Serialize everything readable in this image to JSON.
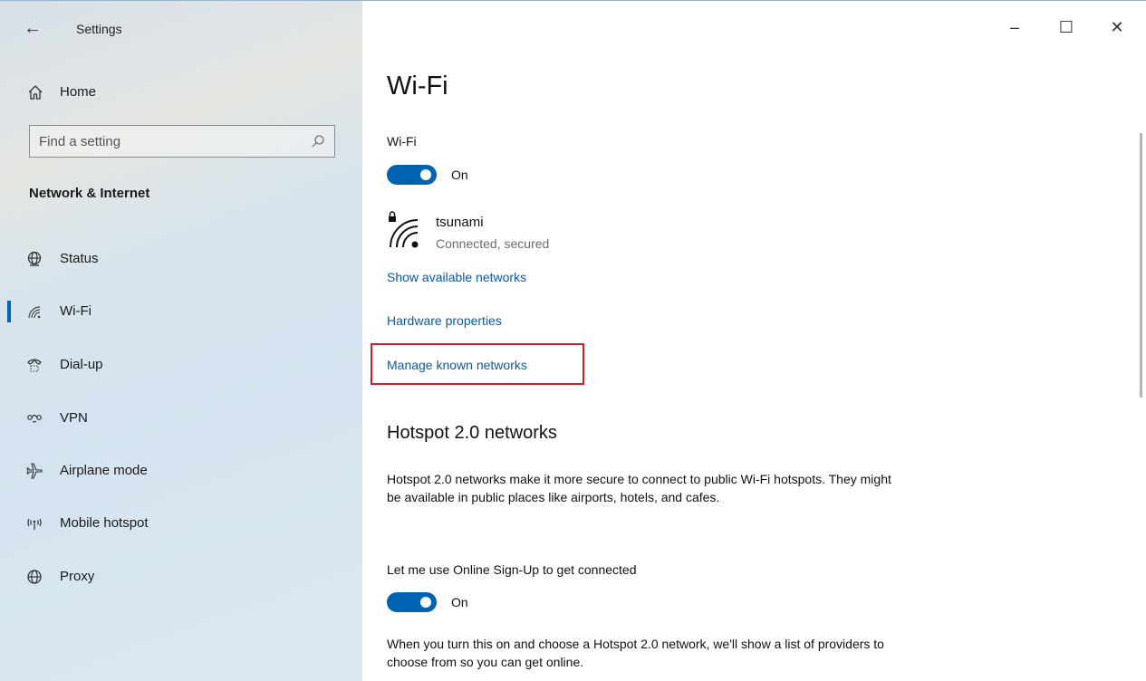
{
  "window": {
    "app_title": "Settings",
    "controls": {
      "minimize": "–",
      "maximize": "☐",
      "close": "✕"
    }
  },
  "sidebar": {
    "back_icon": "back-arrow-icon",
    "home": {
      "label": "Home",
      "icon": "home-icon"
    },
    "search": {
      "placeholder": "Find a setting",
      "icon": "search-icon"
    },
    "section_header": "Network & Internet",
    "items": [
      {
        "label": "Status",
        "icon": "globe-status-icon",
        "selected": false
      },
      {
        "label": "Wi-Fi",
        "icon": "wifi-icon",
        "selected": true
      },
      {
        "label": "Dial-up",
        "icon": "phone-icon",
        "selected": false
      },
      {
        "label": "VPN",
        "icon": "vpn-icon",
        "selected": false
      },
      {
        "label": "Airplane mode",
        "icon": "airplane-icon",
        "selected": false
      },
      {
        "label": "Mobile hotspot",
        "icon": "hotspot-icon",
        "selected": false
      },
      {
        "label": "Proxy",
        "icon": "globe-icon",
        "selected": false
      }
    ]
  },
  "main": {
    "title": "Wi-Fi",
    "wifi_label": "Wi-Fi",
    "wifi_toggle": "On",
    "network": {
      "name": "tsunami",
      "status": "Connected, secured"
    },
    "links": {
      "show_available": "Show available networks",
      "hardware_properties": "Hardware properties",
      "manage_known": "Manage known networks"
    },
    "hotspot": {
      "title": "Hotspot 2.0 networks",
      "description": "Hotspot 2.0 networks make it more secure to connect to public Wi-Fi hotspots. They might be available in public places like airports, hotels, and cafes.",
      "signup_label": "Let me use Online Sign-Up to get connected",
      "signup_toggle": "On",
      "footer": "When you turn this on and choose a Hotspot 2.0 network, we'll show a list of providers to choose from so you can get online."
    }
  },
  "colors": {
    "accent": "#0063b1",
    "link": "#0b5a9c",
    "highlight": "#c8232c"
  }
}
